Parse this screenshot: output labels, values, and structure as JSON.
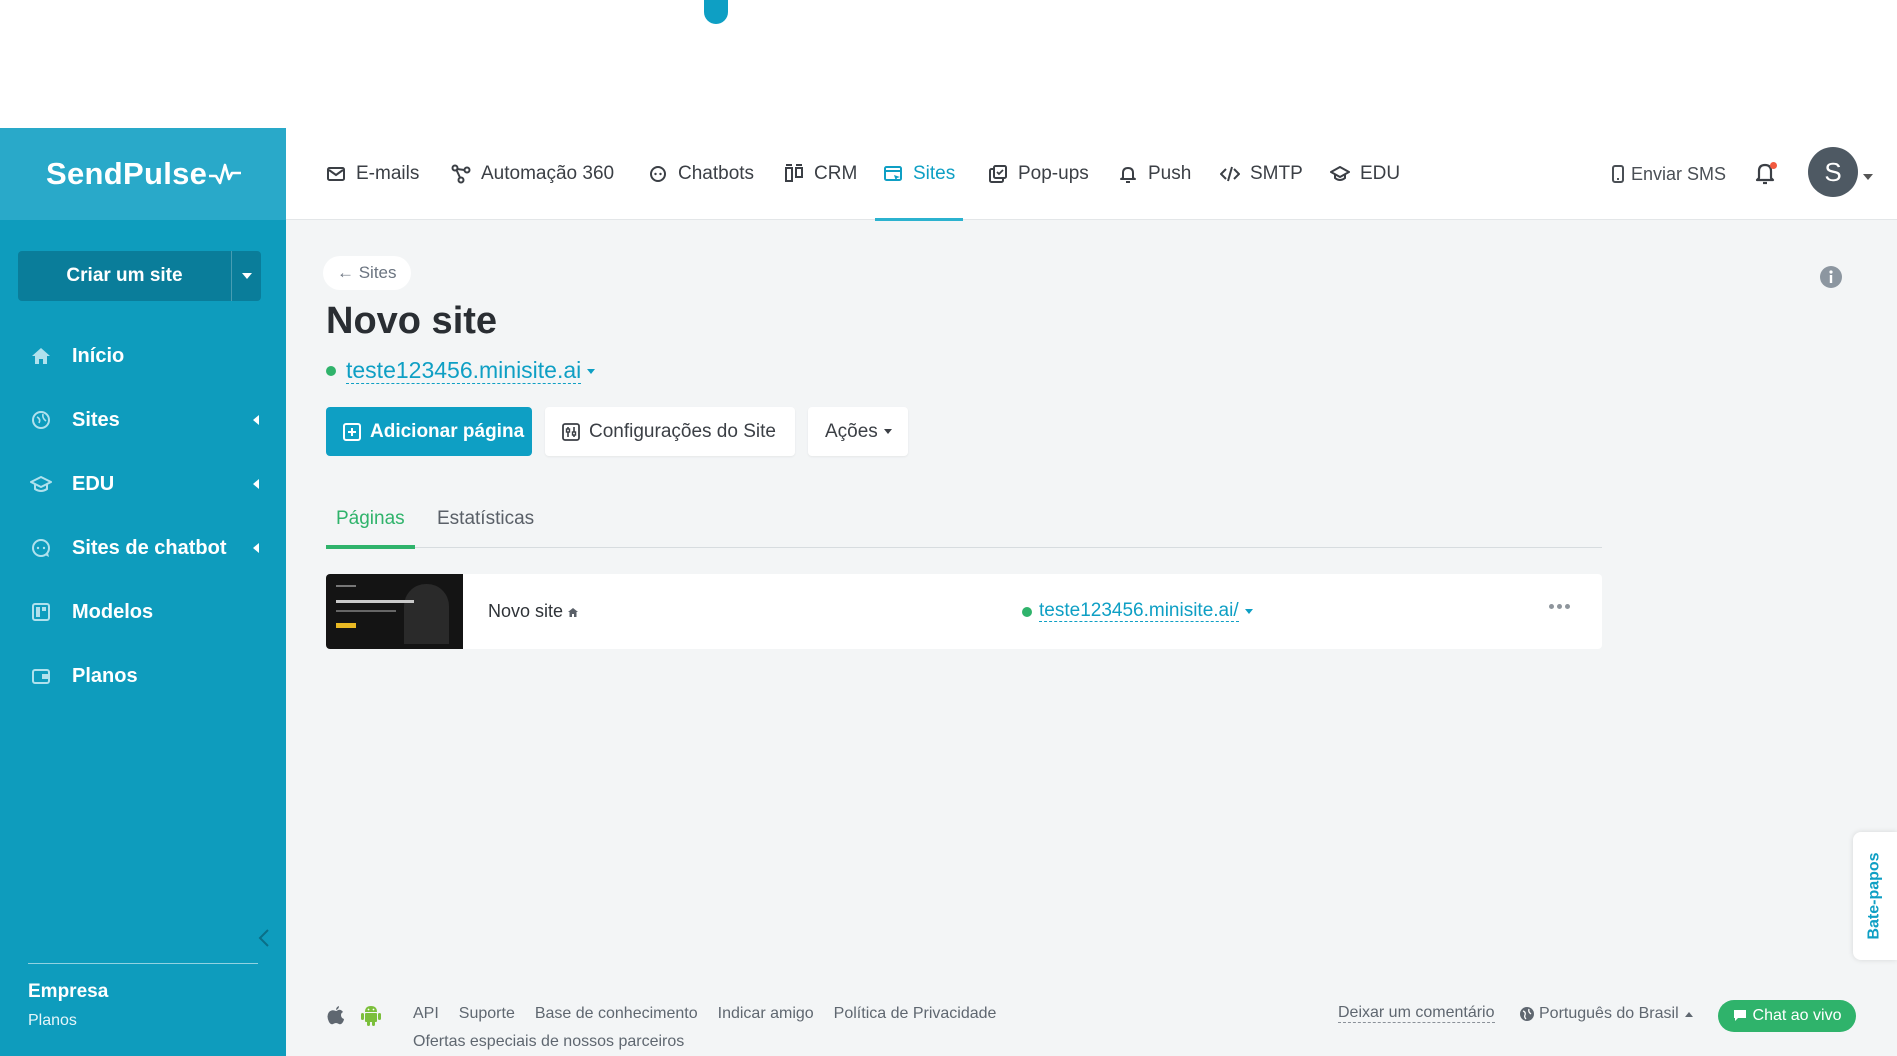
{
  "brand": {
    "name": "SendPulse",
    "accent": "#0e9fc4",
    "sidebar_color": "#0e9cbd",
    "success": "#2fb36b"
  },
  "sidebar": {
    "create_button": "Criar um site",
    "items": [
      {
        "label": "Início",
        "icon": "home-icon"
      },
      {
        "label": "Sites",
        "icon": "globe-icon"
      },
      {
        "label": "EDU",
        "icon": "graduation-cap-icon"
      },
      {
        "label": "Sites de chatbot",
        "icon": "chat-bubble-icon"
      },
      {
        "label": "Modelos",
        "icon": "templates-icon"
      },
      {
        "label": "Planos",
        "icon": "wallet-icon"
      }
    ],
    "plan": {
      "name": "Empresa",
      "sub": "Planos"
    }
  },
  "topnav": {
    "items": [
      {
        "label": "E-mails",
        "icon": "mail-icon"
      },
      {
        "label": "Automação 360",
        "icon": "automation-icon"
      },
      {
        "label": "Chatbots",
        "icon": "chatbot-icon"
      },
      {
        "label": "CRM",
        "icon": "crm-icon"
      },
      {
        "label": "Sites",
        "icon": "sites-icon",
        "active": true
      },
      {
        "label": "Pop-ups",
        "icon": "popup-icon"
      },
      {
        "label": "Push",
        "icon": "bell-icon"
      },
      {
        "label": "SMTP",
        "icon": "code-icon"
      },
      {
        "label": "EDU",
        "icon": "graduation-cap-icon"
      }
    ],
    "send_sms": "Enviar SMS",
    "avatar_initial": "S"
  },
  "page": {
    "back_label": "← Sites",
    "title": "Novo site",
    "domain": "teste123456.minisite.ai",
    "buttons": {
      "add_page": "Adicionar página",
      "settings": "Configurações do Site",
      "actions": "Ações"
    },
    "tabs": [
      {
        "label": "Páginas",
        "active": true
      },
      {
        "label": "Estatísticas",
        "active": false
      }
    ],
    "pages": [
      {
        "name": "Novo site",
        "url": "teste123456.minisite.ai/",
        "is_home": true
      }
    ]
  },
  "chat_tab": "Bate-papos",
  "footer": {
    "links": [
      "API",
      "Suporte",
      "Base de conhecimento",
      "Indicar amigo",
      "Política de Privacidade"
    ],
    "sub": "Ofertas especiais de nossos parceiros",
    "comment": "Deixar um comentário",
    "language": "Português do Brasil",
    "chat_live": "Chat ao vivo"
  }
}
